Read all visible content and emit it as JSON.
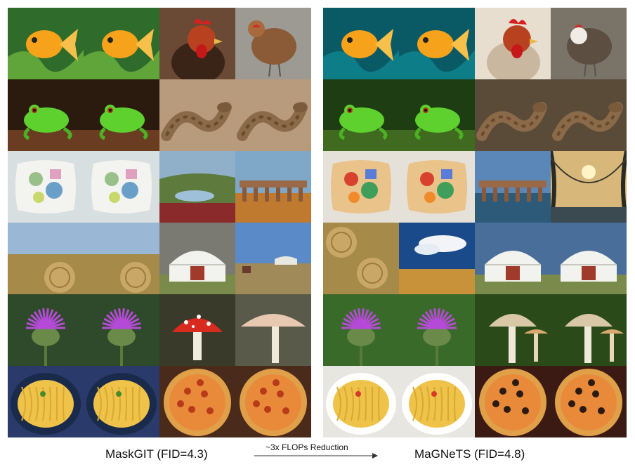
{
  "captions": {
    "left": "MaskGIT (FID=4.3)",
    "right": "MaGNeTS (FID=4.8)",
    "arrow": "~3x FLOPs Reduction"
  },
  "rows": [
    {
      "subject": "goldfish",
      "left": [
        "goldfish",
        "goldfish",
        "rooster",
        "hen"
      ],
      "right": [
        "goldfish",
        "goldfish",
        "rooster",
        "hen"
      ]
    },
    {
      "subject": "frog-snake",
      "left": [
        "tree-frog",
        "tree-frog",
        "snake",
        "snake"
      ],
      "right": [
        "tree-frog",
        "tree-frog",
        "snake",
        "snake"
      ]
    },
    {
      "subject": "pillow-viaduct",
      "left": [
        "pillow",
        "pillow",
        "landscape",
        "viaduct"
      ],
      "right": [
        "pillow",
        "pillow",
        "viaduct",
        "bridge"
      ]
    },
    {
      "subject": "haybale-yurt",
      "left": [
        "haybale",
        "haybale",
        "yurt",
        "yurt-field"
      ],
      "right": [
        "haybale",
        "sky-field",
        "yurt",
        "yurt"
      ]
    },
    {
      "subject": "thistle-mushroom",
      "left": [
        "thistle",
        "thistle",
        "amanita",
        "mushroom"
      ],
      "right": [
        "thistle",
        "thistle",
        "mushroom",
        "mushroom"
      ]
    },
    {
      "subject": "pasta-pizza",
      "left": [
        "pasta",
        "pasta",
        "pizza",
        "pizza"
      ],
      "right": [
        "pasta",
        "pasta",
        "pizza",
        "pizza"
      ]
    }
  ]
}
